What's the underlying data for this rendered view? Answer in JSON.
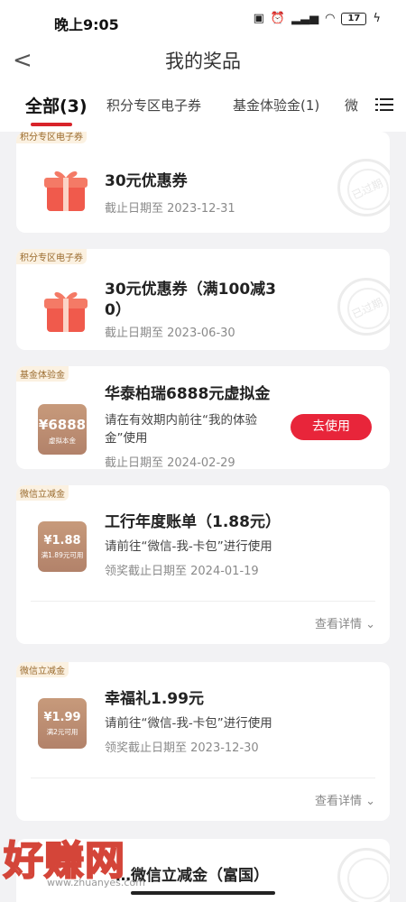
{
  "status": {
    "time": "晚上9:05",
    "battery": "17"
  },
  "nav": {
    "back_label": "<",
    "title": "我的奖品"
  },
  "tabs": [
    {
      "label": "全部(3)"
    },
    {
      "label": "积分专区电子券"
    },
    {
      "label": "基金体验金(1)"
    },
    {
      "label": "微"
    }
  ],
  "cards": [
    {
      "tag": "积分专区电子券",
      "name": "30元优惠券",
      "date": "截止日期至 2023-12-31",
      "stamp": "已过期"
    },
    {
      "tag": "积分专区电子券",
      "name_line1": "30元优惠券（满100减3",
      "name_line2": "0）",
      "date": "截止日期至 2023-06-30",
      "stamp": "已过期"
    },
    {
      "tag": "基金体验金",
      "coupon_amount": "¥6888",
      "coupon_sub": "虚拟本金",
      "name": "华泰柏瑞6888元虚拟金",
      "desc_line1": "请在有效期内前往“我的体验",
      "desc_line2": "金”使用",
      "date": "截止日期至 2024-02-29",
      "button": "去使用"
    },
    {
      "tag": "微信立减金",
      "coupon_amount": "¥1.88",
      "coupon_sub": "满1.89元可用",
      "name": "工行年度账单（1.88元）",
      "desc": "请前往“微信-我-卡包”进行使用",
      "date": "领奖截止日期至 2024-01-19",
      "detail": "查看详情"
    },
    {
      "tag": "微信立减金",
      "coupon_amount": "¥1.99",
      "coupon_sub": "满2元可用",
      "name": "幸福礼1.99元",
      "desc": "请前往“微信-我-卡包”进行使用",
      "date": "领奖截止日期至 2023-12-30",
      "detail": "查看详情"
    },
    {
      "tag": "微信立减金",
      "name": "…微信立减金（富国）"
    }
  ],
  "watermark": {
    "text": "好赚网",
    "url": "www.zhuanyes.com"
  },
  "colors": {
    "accent": "#d8232a",
    "button": "#e8253a",
    "tag_bg": "#fbf1e1",
    "tag_text": "#9a6b2e"
  }
}
